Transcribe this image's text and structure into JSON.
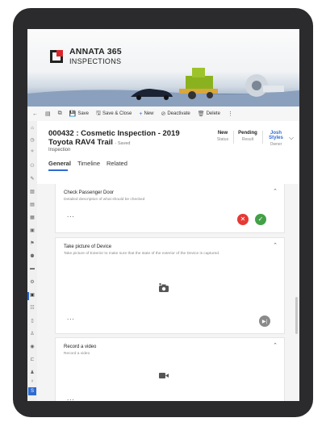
{
  "brand": {
    "name": "ANNATA 365",
    "sub": "INSPECTIONS"
  },
  "commands": [
    {
      "icon": "←",
      "label": ""
    },
    {
      "icon": "▤",
      "label": ""
    },
    {
      "icon": "⧉",
      "label": ""
    },
    {
      "icon": "💾",
      "label": "Save"
    },
    {
      "icon": "🖫",
      "label": "Save & Close"
    },
    {
      "icon": "+",
      "label": "New"
    },
    {
      "icon": "⊘",
      "label": "Deactivate"
    },
    {
      "icon": "🗑",
      "label": "Delete"
    },
    {
      "icon": "⋮",
      "label": ""
    }
  ],
  "record": {
    "title": "000432 : Cosmetic Inspection - 2019 Toyota RAV4 Trail",
    "saved": "- Saved",
    "entity": "Inspection",
    "status": {
      "value": "New",
      "label": "Status"
    },
    "result": {
      "value": "Pending",
      "label": "Result"
    },
    "owner": {
      "value": "Josh Styles",
      "label": "Owner"
    }
  },
  "tabs": [
    "General",
    "Timeline",
    "Related"
  ],
  "cards": [
    {
      "title": "Check Passenger Door",
      "desc": "Detailed description of what should be checked",
      "dots": "..."
    },
    {
      "title": "Take picture of Device",
      "desc": "Take picture of Exterior to make sure that the state of the exterior of the Device is captured.",
      "dots": "..."
    },
    {
      "title": "Record a video",
      "desc": "Record a video",
      "dots": "..."
    }
  ],
  "colors": {
    "accent": "#2f6bd1",
    "reject": "#e53935",
    "accept": "#43a047"
  }
}
